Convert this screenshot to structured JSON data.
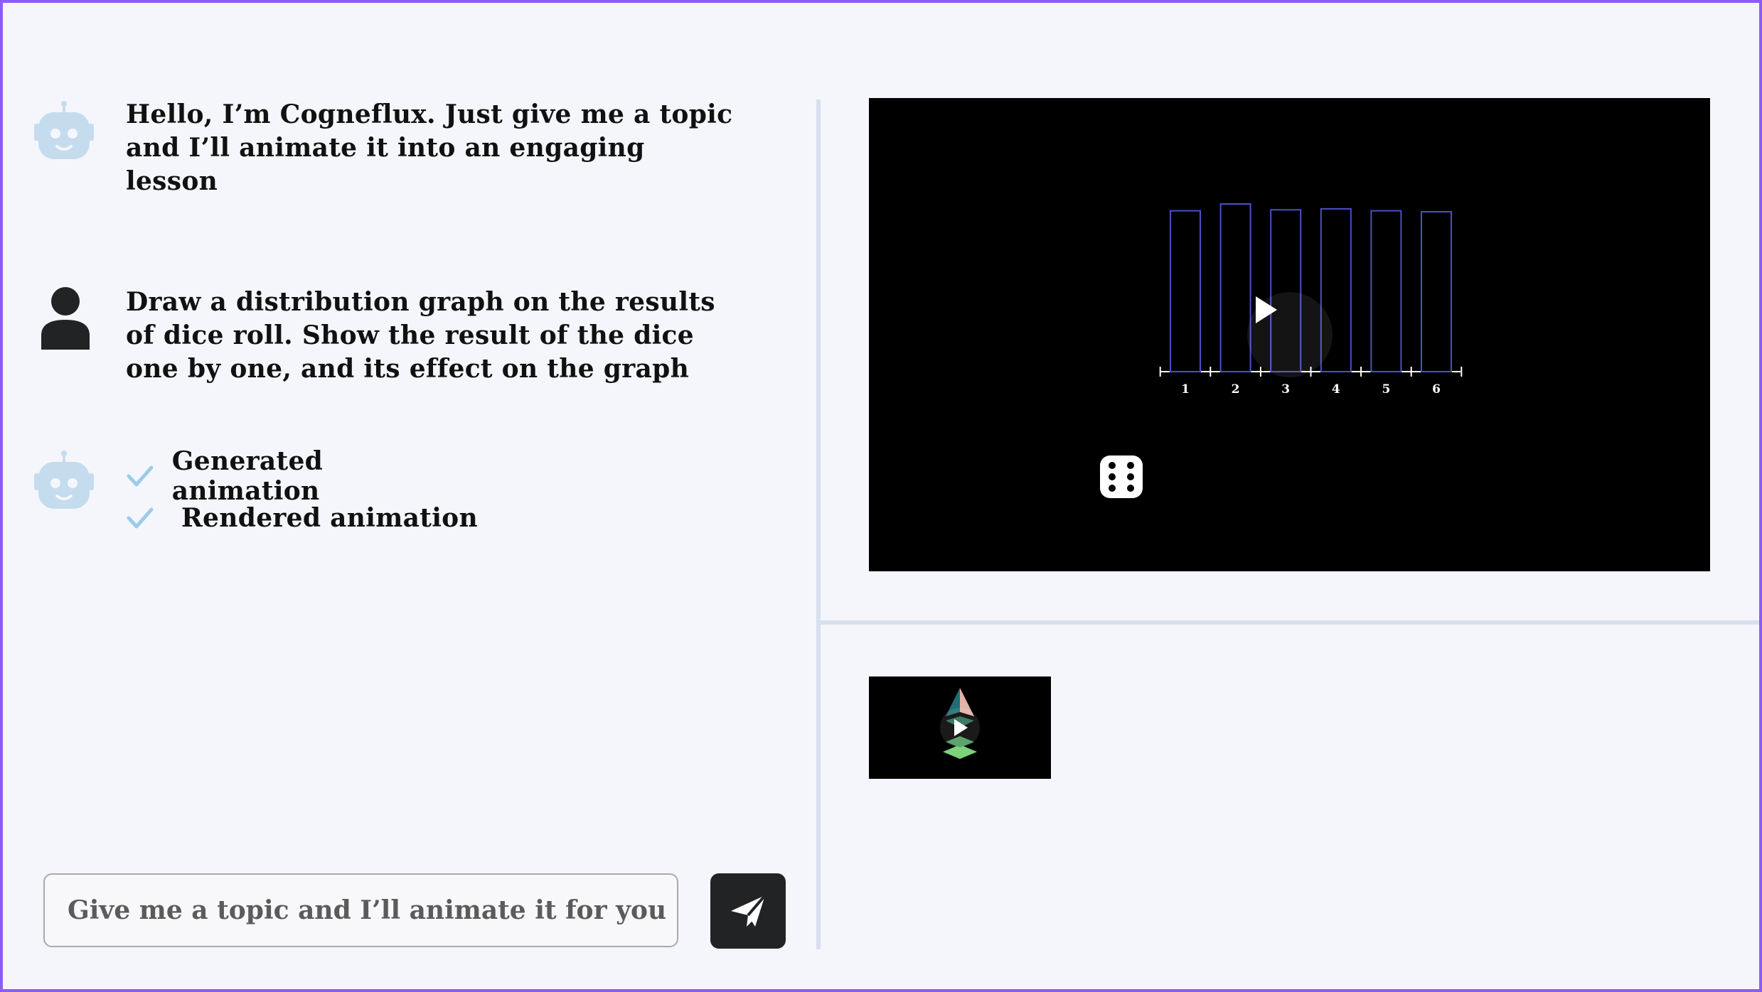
{
  "chat": {
    "messages": [
      {
        "role": "bot",
        "text": "Hello, I’m Cogneflux. Just give me a topic and I’ll animate it into an engaging lesson"
      },
      {
        "role": "user",
        "text": "Draw a distribution graph on the results of dice roll. Show the result of the dice one by one, and its effect on the graph"
      }
    ],
    "steps": [
      {
        "label": "Generated animation",
        "status": "done"
      },
      {
        "label": " Rendered animation",
        "status": "done"
      }
    ]
  },
  "composer": {
    "placeholder": "Give me a topic and I’ll animate it for you",
    "value": ""
  },
  "colors": {
    "frame": "#8b5cf6",
    "bot_icon": "#c5dcee",
    "check": "#9ccbe9",
    "bar_stroke": "#4b4fc8",
    "send_button": "#222325"
  },
  "video": {
    "icon": "play-icon",
    "chart_data": {
      "type": "bar",
      "categories": [
        "1",
        "2",
        "3",
        "4",
        "5",
        "6"
      ],
      "values": [
        0.165,
        0.172,
        0.166,
        0.167,
        0.165,
        0.164
      ],
      "ylim": [
        0,
        0.2
      ],
      "grid": false
    },
    "dice_face": 6
  },
  "thumbnail": {
    "icon": "play-icon"
  }
}
